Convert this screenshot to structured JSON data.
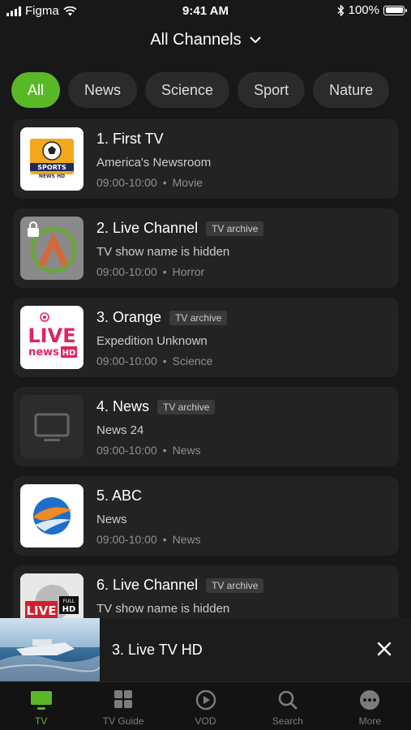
{
  "status_bar": {
    "carrier": "Figma",
    "time": "9:41 AM",
    "battery": "100%"
  },
  "header": {
    "title": "All Channels"
  },
  "filters": [
    "All",
    "News",
    "Science",
    "Sport",
    "Nature"
  ],
  "channels": [
    {
      "title": "1. First TV",
      "badge": "",
      "show": "America's Newsroom",
      "time": "09:00-10:00",
      "separator": "•",
      "genre": "Movie",
      "logo_text_1": "SPORTS",
      "logo_text_2": "NEWS HD"
    },
    {
      "title": "2. Live Channel",
      "badge": "TV archive",
      "show": "TV show name is hidden",
      "time": "09:00-10:00",
      "separator": "•",
      "genre": "Horror"
    },
    {
      "title": "3. Orange",
      "badge": "TV archive",
      "show": "Expedition Unknown",
      "time": "09:00-10:00",
      "separator": "•",
      "genre": "Science",
      "logo_text_1": "LIVE",
      "logo_text_2": "news",
      "logo_text_3": "HD"
    },
    {
      "title": "4. News",
      "badge": "TV archive",
      "show": "News 24",
      "time": "09:00-10:00",
      "separator": "•",
      "genre": "News"
    },
    {
      "title": "5. ABC",
      "badge": "",
      "show": "News",
      "time": "09:00-10:00",
      "separator": "•",
      "genre": "News"
    },
    {
      "title": "6. Live Channel",
      "badge": "TV archive",
      "show": "TV show name is hidden",
      "time": "",
      "separator": "",
      "genre": "",
      "logo_text_1": "LIVE",
      "logo_text_2": "FULL",
      "logo_text_3": "HD"
    }
  ],
  "mini_player": {
    "title": "3. Live TV HD"
  },
  "tabs": [
    {
      "label": "TV",
      "icon": "tv-icon"
    },
    {
      "label": "TV Guide",
      "icon": "grid-icon"
    },
    {
      "label": "VOD",
      "icon": "play-icon"
    },
    {
      "label": "Search",
      "icon": "search-icon"
    },
    {
      "label": "More",
      "icon": "more-icon"
    }
  ],
  "colors": {
    "accent": "#5ab827",
    "background": "#181818",
    "card": "#232323"
  }
}
